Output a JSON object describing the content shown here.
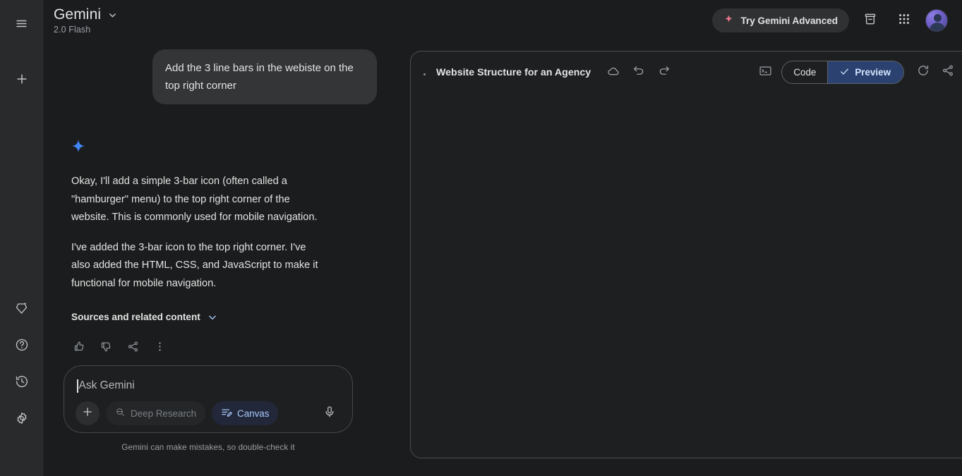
{
  "rail": {
    "menu_icon": "hamburger-menu-icon",
    "new_chat_icon": "plus-icon",
    "bottom_items": [
      {
        "icon": "gem-sparkle-icon",
        "name": "upgrade"
      },
      {
        "icon": "help-circle-icon",
        "name": "help"
      },
      {
        "icon": "history-clock-icon",
        "name": "activity"
      },
      {
        "icon": "settings-gear-icon",
        "name": "settings"
      }
    ]
  },
  "header": {
    "title": "Gemini",
    "model": "2.0 Flash",
    "dropdown_icon": "chevron-down-icon",
    "advanced_label": "Try Gemini Advanced",
    "advanced_icon": "sparkle-icon",
    "advanced_icon_color": "#e8748a",
    "archive_icon": "archive-icon",
    "apps_icon": "apps-grid-icon",
    "avatar_icon": "user-avatar"
  },
  "conversation": {
    "user_message": "Add the 3 line bars in the webiste on the top right corner",
    "assistant_icon": "gemini-spark-icon",
    "assistant_icon_color": "#4285f4",
    "assistant_paragraphs": [
      "Okay, I'll add a simple 3-bar icon (often called a \"hamburger\" menu) to the top right corner of the website. This is commonly used for mobile navigation.",
      "I've added the 3-bar icon to the top right corner.  I've also added the HTML, CSS, and JavaScript to make it functional for mobile navigation."
    ],
    "sources_label": "Sources and related content",
    "sources_chevron_icon": "chevron-down-icon",
    "actions": [
      {
        "icon": "thumbs-up-icon",
        "name": "like"
      },
      {
        "icon": "thumbs-down-icon",
        "name": "dislike"
      },
      {
        "icon": "share-icon",
        "name": "share"
      },
      {
        "icon": "more-vert-icon",
        "name": "more-options"
      }
    ]
  },
  "composer": {
    "placeholder": "Ask Gemini",
    "value": "",
    "add_icon": "plus-icon",
    "deep_research_label": "Deep Research",
    "deep_research_icon": "deep-research-icon",
    "canvas_label": "Canvas",
    "canvas_icon": "canvas-edit-icon",
    "canvas_active_color": "#a8c7fa",
    "mic_icon": "microphone-icon",
    "disclaimer": "Gemini can make mistakes, so double-check it"
  },
  "canvas": {
    "title": "Website Structure for an Agency",
    "cloud_icon": "cloud-icon",
    "undo_icon": "undo-icon",
    "redo_icon": "redo-icon",
    "terminal_icon": "terminal-icon",
    "code_label": "Code",
    "preview_label": "Preview",
    "preview_check_icon": "check-icon",
    "active_tab": "Preview",
    "active_color": "#2b4270",
    "refresh_icon": "refresh-icon",
    "share_icon": "share-icon",
    "close_icon": "close-icon",
    "content": ""
  }
}
